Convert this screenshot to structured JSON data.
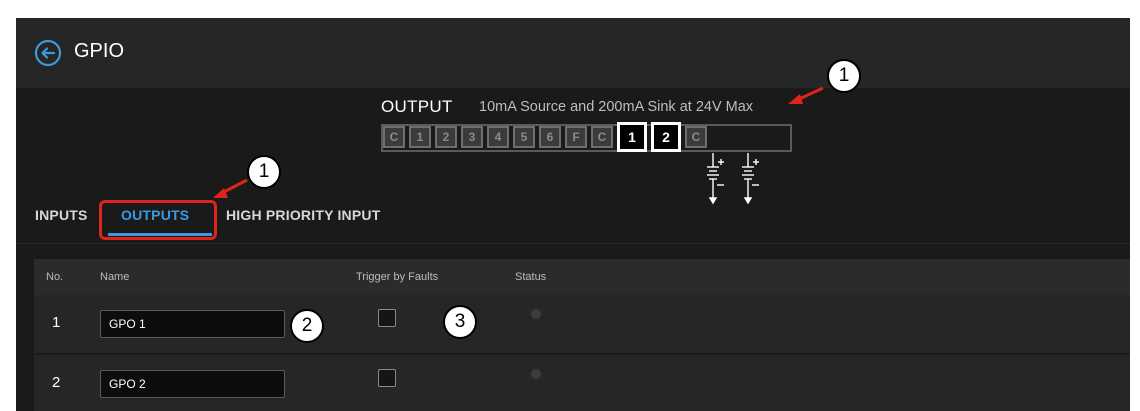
{
  "header": {
    "title": "GPIO",
    "back_icon": "back-arrow-circle-icon"
  },
  "output_panel": {
    "label": "OUTPUT",
    "spec": "10mA Source and 200mA Sink at 24V Max",
    "pins": [
      "C",
      "1",
      "2",
      "3",
      "4",
      "5",
      "6",
      "F",
      "C",
      "1",
      "2",
      "C"
    ],
    "active_pins": [
      9,
      10
    ],
    "battery_icon": "battery-symbol-icon"
  },
  "tabs": [
    {
      "label": "INPUTS",
      "active": false
    },
    {
      "label": "OUTPUTS",
      "active": true
    },
    {
      "label": "HIGH PRIORITY INPUT",
      "active": false
    }
  ],
  "table": {
    "columns": {
      "no": "No.",
      "name": "Name",
      "trigger": "Trigger by Faults",
      "status": "Status"
    },
    "rows": [
      {
        "no": "1",
        "name": "GPO 1",
        "trigger": false,
        "status": "off"
      },
      {
        "no": "2",
        "name": "GPO 2",
        "trigger": false,
        "status": "off"
      }
    ]
  },
  "callouts": [
    "1",
    "1",
    "2",
    "3"
  ],
  "colors": {
    "accent": "#3a9be0",
    "annotation": "#e0231b",
    "panel_bg": "#1a1a1a"
  }
}
